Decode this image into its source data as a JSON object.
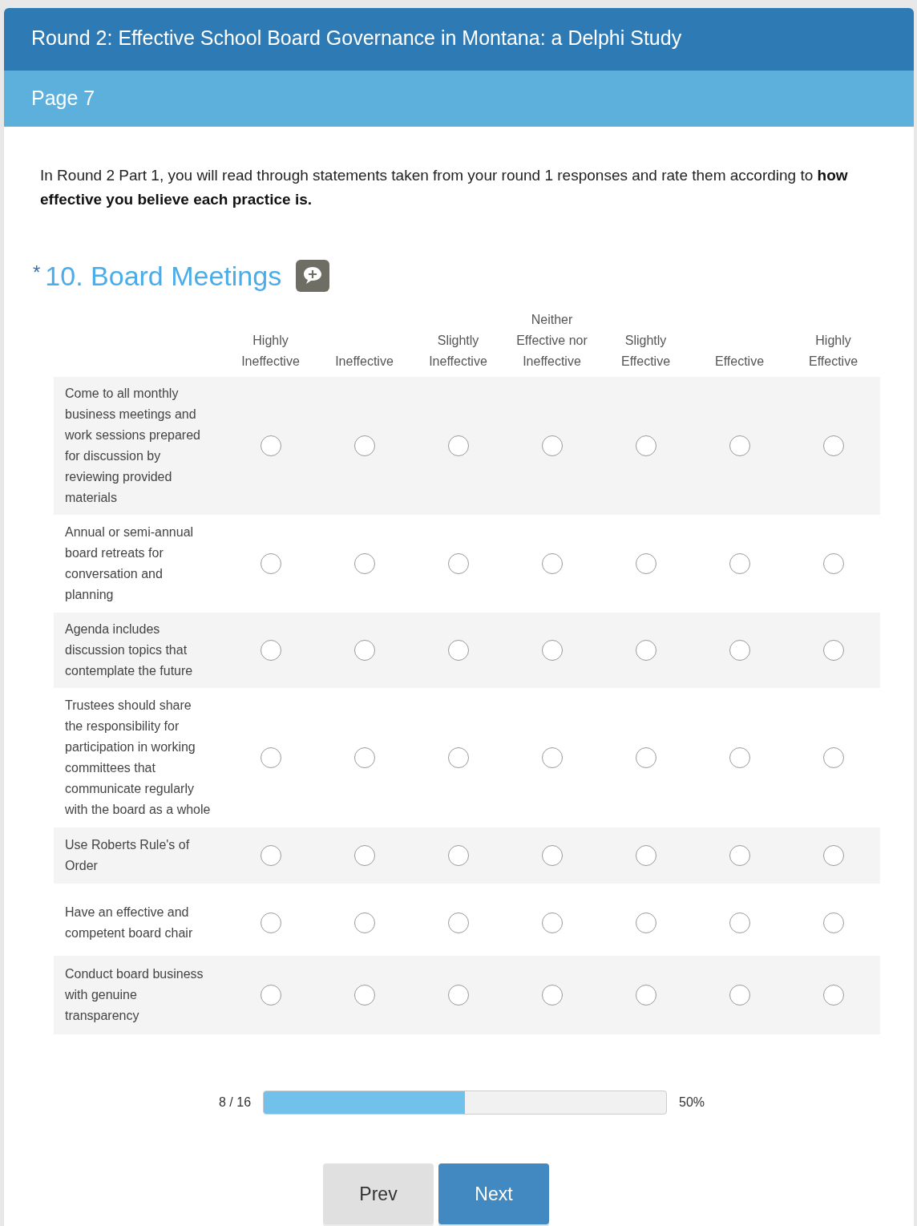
{
  "survey_title": "Round 2: Effective School Board Governance in Montana:  a Delphi Study",
  "page_title": "Page 7",
  "intro": "In Round 2 Part 1, you will read through statements taken from your round 1 responses and rate them according to **how effective you believe each practice is.**",
  "question": {
    "required_mark": "*",
    "title": "10. Board Meetings"
  },
  "columns": [
    "Highly Ineffective",
    "Ineffective",
    "Slightly Ineffective",
    "Neither Effective nor Ineffective",
    "Slightly Effective",
    "Effective",
    "Highly Effective"
  ],
  "rows": [
    {
      "label": "Come to all monthly business meetings and work sessions prepared for discussion by reviewing provided materials",
      "options": [
        {
          "selected": false
        },
        {
          "selected": false
        },
        {
          "selected": false
        },
        {
          "selected": false
        },
        {
          "selected": false
        },
        {
          "selected": false
        },
        {
          "selected": false
        }
      ]
    },
    {
      "label": "Annual or semi-annual board retreats for conversation and planning",
      "options": [
        {
          "selected": false
        },
        {
          "selected": false
        },
        {
          "selected": false
        },
        {
          "selected": false
        },
        {
          "selected": false
        },
        {
          "selected": false
        },
        {
          "selected": false
        }
      ]
    },
    {
      "label": "Agenda includes discussion topics that contemplate the future",
      "options": [
        {
          "selected": false
        },
        {
          "selected": false
        },
        {
          "selected": false
        },
        {
          "selected": false
        },
        {
          "selected": false
        },
        {
          "selected": false
        },
        {
          "selected": false
        }
      ]
    },
    {
      "label": "Trustees should share the responsibility for participation in working committees that communicate regularly with the board as a whole",
      "options": [
        {
          "selected": false
        },
        {
          "selected": false
        },
        {
          "selected": false
        },
        {
          "selected": false
        },
        {
          "selected": false
        },
        {
          "selected": false
        },
        {
          "selected": false
        }
      ]
    },
    {
      "label": "Use Roberts Rule's of Order",
      "options": [
        {
          "selected": false
        },
        {
          "selected": false
        },
        {
          "selected": false
        },
        {
          "selected": false
        },
        {
          "selected": false
        },
        {
          "selected": false
        },
        {
          "selected": false
        }
      ]
    },
    {
      "label": "Have an effective and competent board chair",
      "options": [
        {
          "selected": false
        },
        {
          "selected": false
        },
        {
          "selected": false
        },
        {
          "selected": false
        },
        {
          "selected": false
        },
        {
          "selected": false
        },
        {
          "selected": false
        }
      ]
    },
    {
      "label": "Conduct board business with genuine transparency",
      "options": [
        {
          "selected": false
        },
        {
          "selected": false
        },
        {
          "selected": false
        },
        {
          "selected": false
        },
        {
          "selected": false
        },
        {
          "selected": false
        },
        {
          "selected": false
        }
      ]
    }
  ],
  "progress": {
    "count": "8 / 16",
    "level": 0.5,
    "percent": "50%"
  },
  "buttons": [
    "Prev",
    "Next"
  ]
}
